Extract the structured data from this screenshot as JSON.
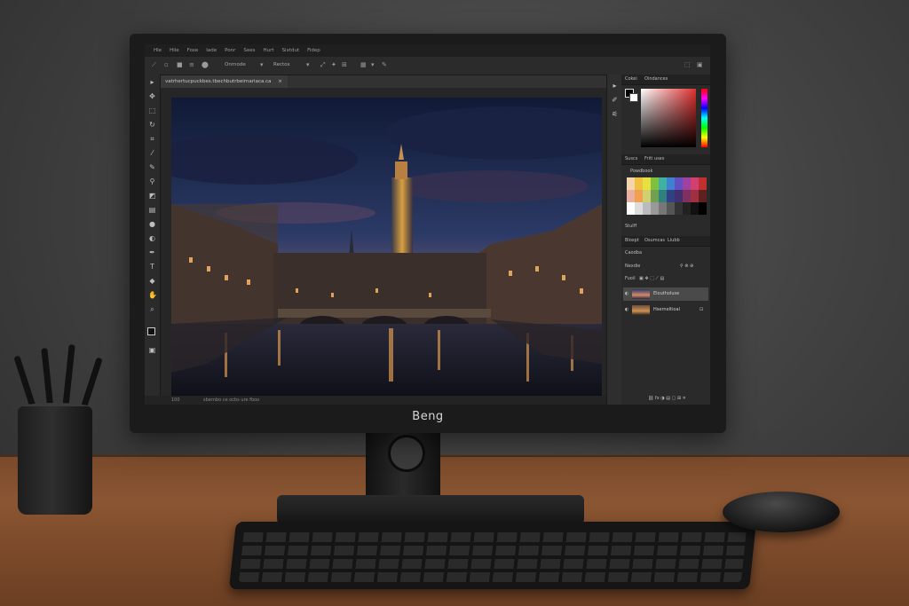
{
  "monitor": {
    "brand": "Beng"
  },
  "menu": [
    "Hle",
    "Hile",
    "Foxe",
    "Iade",
    "Ponr",
    "Sees",
    "Hurt",
    "Sixtdut",
    "Fidep"
  ],
  "options": {
    "blend_mode": "Onrnode",
    "sample": "Rectox"
  },
  "document_tab": "vatrhertucpuckbes.tbechbutrbeirnariaca.ca",
  "status": {
    "left": "100",
    "right": "sbernbo ce ocbs ure fboo"
  },
  "panels": {
    "color": {
      "tabs": [
        "Cokei",
        "Oindances"
      ],
      "colors": {
        "fg": "#000000",
        "picker_hue": "#e03030"
      }
    },
    "swatches": {
      "tabs": [
        "Suscs",
        "Friti uses"
      ],
      "group_label": "Powdbook"
    },
    "mode_label": "Stulff",
    "layers": {
      "tabs": [
        "Bloxpt",
        "Osumcas",
        "Liubb"
      ],
      "blend": "Caodba",
      "opacity_label": "Nexdie",
      "fill_label": "Fuoil",
      "items": [
        {
          "name": "Eloutholuse",
          "selected": true
        },
        {
          "name": "Hserneltioal",
          "selected": false
        }
      ]
    }
  },
  "icons": [
    "arrow-icon",
    "move-icon",
    "marquee-icon",
    "lasso-icon",
    "crop-icon",
    "eyedropper-icon",
    "brush-icon",
    "clone-icon",
    "eraser-icon",
    "gradient-icon",
    "blur-icon",
    "dodge-icon",
    "pen-icon",
    "type-icon",
    "shape-icon",
    "hand-icon",
    "zoom-icon",
    "color-swatch-icon"
  ]
}
